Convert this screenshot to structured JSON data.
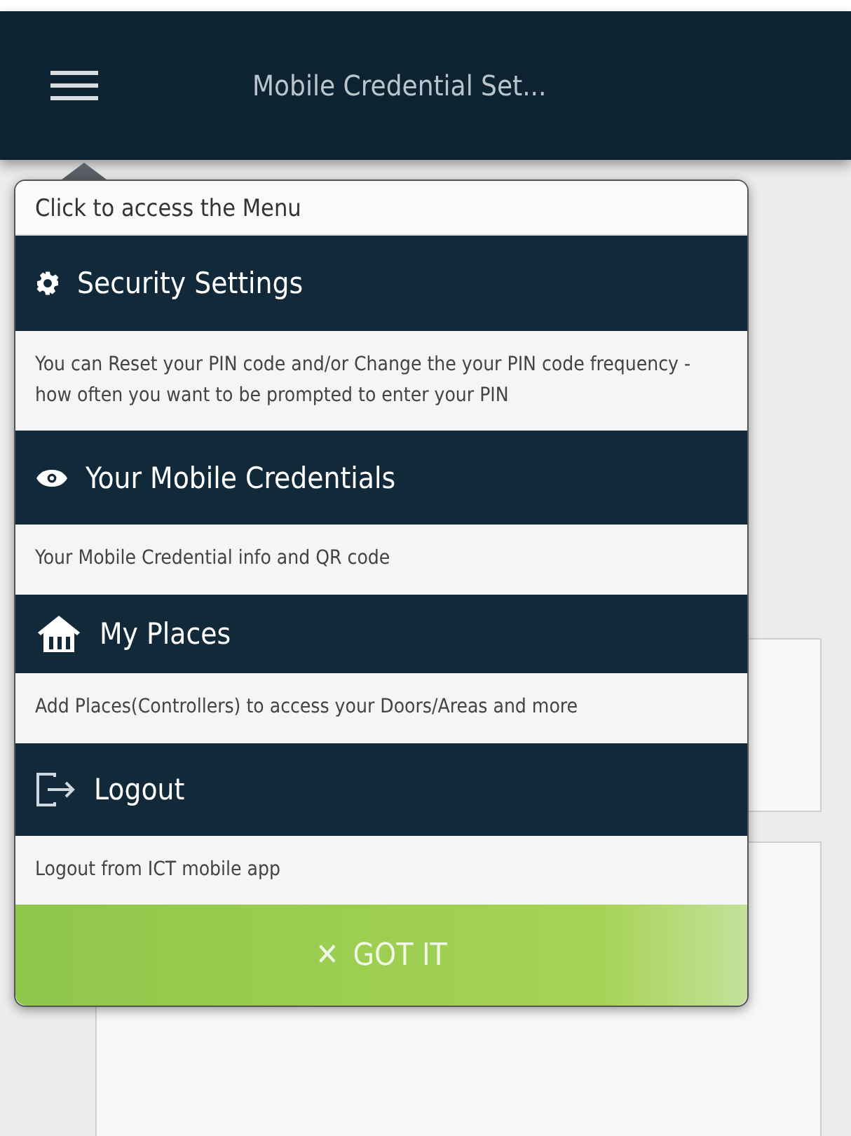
{
  "header": {
    "title": "Mobile Credential Set..."
  },
  "menu_guide": {
    "caption": "Click to access the Menu",
    "items": [
      {
        "label": "Security Settings",
        "description": "You can Reset your PIN code and/or Change the your PIN code frequency - how often you want to be prompted to enter your PIN"
      },
      {
        "label": "Your Mobile Credentials",
        "description": "Your Mobile Credential info and QR code"
      },
      {
        "label": "My Places",
        "description": "Add Places(Controllers) to access your Doors/Areas and more"
      },
      {
        "label": "Logout",
        "description": "Logout from ICT mobile app"
      }
    ],
    "dismiss_button": {
      "icon": "✕",
      "label": "GOT IT"
    }
  }
}
